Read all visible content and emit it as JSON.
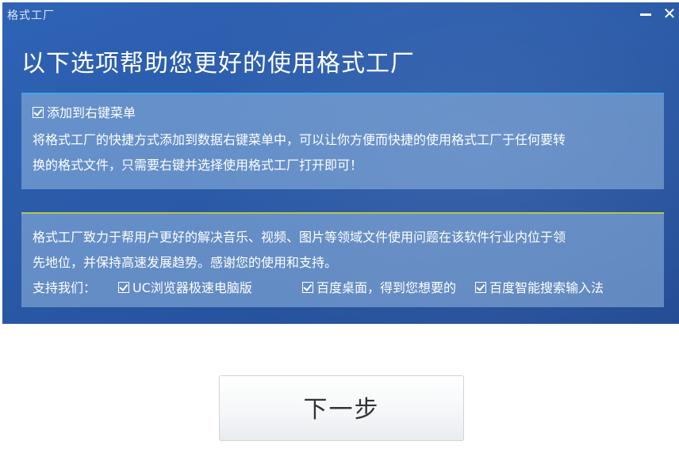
{
  "window": {
    "title": "格式工厂",
    "minimize_label": "_",
    "close_label": "✕"
  },
  "header": {
    "headline": "以下选项帮助您更好的使用格式工厂"
  },
  "panel_context_menu": {
    "checkbox_label": "添加到右键菜单",
    "checked": true,
    "desc_line1": "将格式工厂的快捷方式添加到数据右键菜单中，可以让你方便而快捷的使用格式工厂于任何要转",
    "desc_line2": "换的格式文件，只需要右键并选择使用格式工厂打开即可！"
  },
  "panel_support": {
    "desc_line1": "格式工厂致力于帮用户更好的解决音乐、视频、图片等领域文件使用问题在该软件行业内位于领",
    "desc_line2": "先地位，并保持高速发展趋势。感谢您的使用和支持。",
    "support_label": "支持我们：",
    "options": [
      {
        "label": "UC浏览器极速电脑版",
        "checked": true
      },
      {
        "label": "百度桌面，得到您想要的",
        "checked": true
      },
      {
        "label": "百度智能搜索输入法",
        "checked": true
      }
    ]
  },
  "footer": {
    "next_label": "下一步"
  },
  "colors": {
    "header_bg": "#2a5aa8",
    "panel_bg": "#8fb2dc",
    "panel1_accent": "#3fa6e8",
    "panel2_accent": "#b7c64a"
  },
  "icons": {
    "checkbox": "checkbox-checked-icon",
    "minimize": "minimize-icon",
    "close": "close-icon"
  }
}
